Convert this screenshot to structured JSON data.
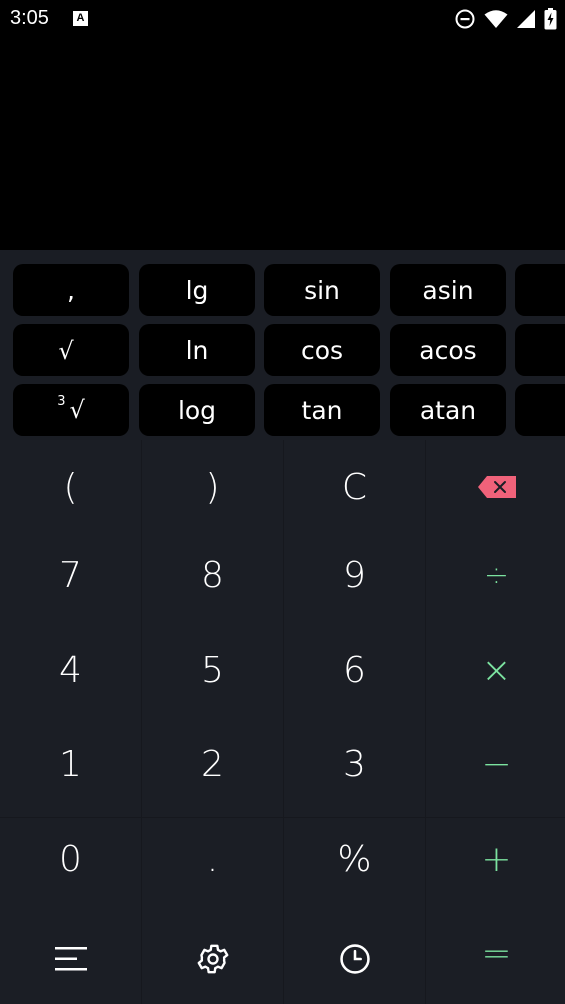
{
  "status_bar": {
    "time": "3:05",
    "notification_letter": "A",
    "icons": [
      "do-not-disturb-icon",
      "wifi-icon",
      "signal-icon",
      "battery-charging-icon"
    ]
  },
  "display": {
    "expression": "",
    "result": ""
  },
  "scientific": {
    "rows": [
      [
        "",
        "lg",
        "sin",
        "asin"
      ],
      [
        "",
        "ln",
        "cos",
        "acos"
      ],
      [
        "",
        "log",
        "tan",
        "atan"
      ]
    ],
    "comma": ",",
    "sqrt": "√",
    "cbrt_index": "3",
    "cbrt_radical": "√"
  },
  "keypad": {
    "row1": [
      "(",
      ")",
      "C"
    ],
    "row2": [
      "7",
      "8",
      "9",
      "÷"
    ],
    "row3": [
      "4",
      "5",
      "6",
      "×"
    ],
    "row4": [
      "1",
      "2",
      "3",
      "−"
    ],
    "row5": [
      "0",
      ".",
      "%",
      "+"
    ],
    "equals": "="
  },
  "bottom_icons": [
    "menu-icon",
    "settings-icon",
    "history-icon"
  ],
  "colors": {
    "accent": "#7ce3a0",
    "backspace": "#f0627a",
    "pad_bg": "#1b1e25",
    "sci_key_bg": "#000000"
  }
}
